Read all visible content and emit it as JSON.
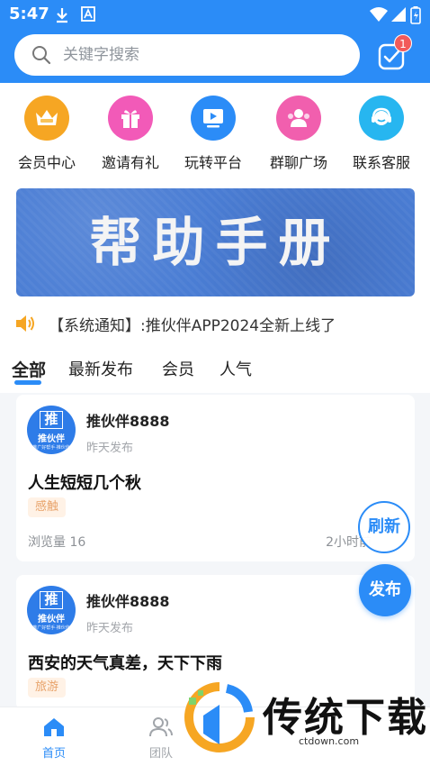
{
  "status_bar": {
    "time": "5:47"
  },
  "search": {
    "placeholder": "关键字搜索"
  },
  "messages": {
    "badge_count": "1"
  },
  "entries": [
    {
      "label": "会员中心",
      "icon": "crown-icon",
      "color": "#f6a623"
    },
    {
      "label": "邀请有礼",
      "icon": "gift-icon",
      "color": "#f25ab8"
    },
    {
      "label": "玩转平台",
      "icon": "play-screen-icon",
      "color": "#2b8cf7"
    },
    {
      "label": "群聊广场",
      "icon": "group-chat-icon",
      "color": "#f15fae"
    },
    {
      "label": "联系客服",
      "icon": "customer-service-icon",
      "color": "#27b6f0"
    }
  ],
  "banner": {
    "text": "帮助手册"
  },
  "notice": {
    "text": "【系统通知】:推伙伴APP2024全新上线了"
  },
  "tabs": [
    {
      "label": "全部",
      "active": true
    },
    {
      "label": "最新发布",
      "active": false
    },
    {
      "label": "会员",
      "active": false
    },
    {
      "label": "人气",
      "active": false
    }
  ],
  "posts": [
    {
      "avatar_big": "推",
      "avatar_small": "推伙伴",
      "avatar_tiny": "推广好帮手·推伙伴",
      "user": "推伙伴8888",
      "time": "昨天发布",
      "title": "人生短短几个秋",
      "tag": "感触",
      "views": "浏览量 16",
      "ago": "2小时前"
    },
    {
      "avatar_big": "推",
      "avatar_small": "推伙伴",
      "avatar_tiny": "推广好帮手·推伙伴",
      "user": "推伙伴8888",
      "time": "昨天发布",
      "title": "西安的天气真差，天下下雨",
      "tag": "旅游"
    }
  ],
  "fab": {
    "refresh": "刷新",
    "publish": "发布"
  },
  "bottom_nav": [
    {
      "label": "首页",
      "icon": "home-icon",
      "active": true
    },
    {
      "label": "团队",
      "icon": "team-icon",
      "active": false
    }
  ],
  "watermark": {
    "text": "传统下载",
    "url": "ctdown.com"
  },
  "colors": {
    "primary": "#2b8cf7",
    "tag_bg": "#fff2e6",
    "tag_text": "#e8a36a",
    "badge": "#f25a5a"
  }
}
